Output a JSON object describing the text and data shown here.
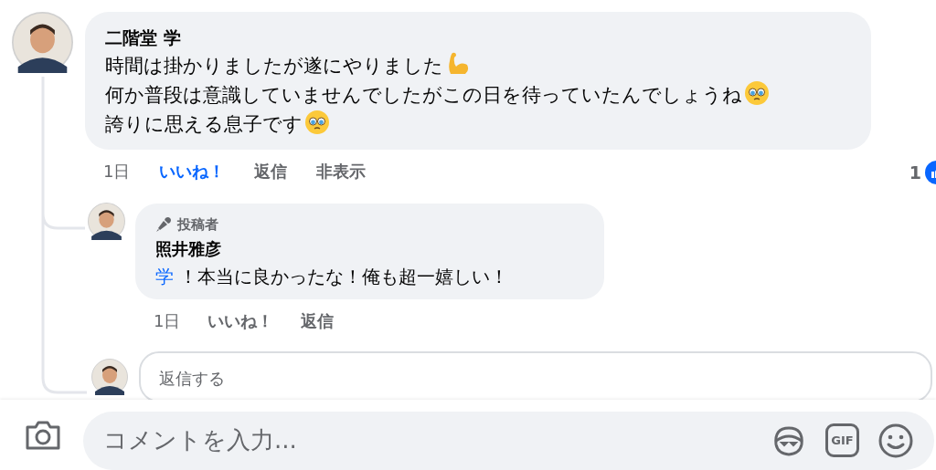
{
  "comment": {
    "author": "二階堂 学",
    "lines": [
      {
        "text": "時間は掛かりましたが遂にやりました",
        "kind": "flexed-arm"
      },
      {
        "text": "何か普段は意識していませんでしたがこの日を待っていたんでしょうね",
        "kind": "teary-face"
      },
      {
        "text": "誇りに思える息子です",
        "kind": "teary-face"
      }
    ],
    "time": "1日",
    "like": {
      "label": "いいね！",
      "selected": true
    },
    "reply": "返信",
    "hide": "非表示",
    "like_count": "1"
  },
  "reply": {
    "badge": "投稿者",
    "author": "照井雅彦",
    "mention": "学",
    "text": "！本当に良かったな！俺も超一嬉しい！",
    "time": "1日",
    "like": {
      "label": "いいね！",
      "selected": false
    },
    "reply": "返信"
  },
  "reply_field": {
    "placeholder": "返信する"
  },
  "composer": {
    "placeholder": "コメントを入力...",
    "gif_label": "GIF"
  }
}
